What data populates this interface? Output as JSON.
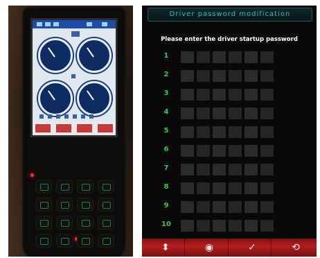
{
  "screen": {
    "title": "Driver password modification",
    "prompt": "Please enter the driver startup password",
    "rows": [
      {
        "label": "1"
      },
      {
        "label": "2"
      },
      {
        "label": "3"
      },
      {
        "label": "4"
      },
      {
        "label": "5"
      },
      {
        "label": "6"
      },
      {
        "label": "7"
      },
      {
        "label": "8"
      },
      {
        "label": "9"
      },
      {
        "label": "10"
      }
    ],
    "actions": [
      {
        "name": "up-down-icon",
        "glyph": "⬍"
      },
      {
        "name": "eye-icon",
        "glyph": "◉"
      },
      {
        "name": "checkmark-icon",
        "glyph": "✓"
      },
      {
        "name": "refresh-icon",
        "glyph": "⟲"
      }
    ]
  },
  "colors": {
    "title_text": "#3fb6b9",
    "row_number": "#35c94e",
    "action_bar": "#b41e1e",
    "background": "#090909"
  }
}
